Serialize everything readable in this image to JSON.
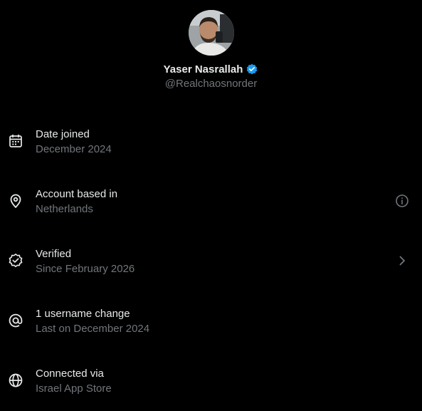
{
  "profile": {
    "name": "Yaser Nasrallah",
    "handle": "@Realchaosnorder",
    "verified_badge_icon": "verified-badge-icon",
    "badge_color": "#1d9bf0"
  },
  "rows": [
    {
      "title": "Date joined",
      "subtitle": "December 2024",
      "icon": "calendar-icon"
    },
    {
      "title": "Account based in",
      "subtitle": "Netherlands",
      "icon": "location-pin-icon",
      "action_icon": "info-icon"
    },
    {
      "title": "Verified",
      "subtitle": "Since February 2026",
      "icon": "verified-check-icon",
      "action_icon": "chevron-right-icon"
    },
    {
      "title": "1 username change",
      "subtitle": "Last on December 2024",
      "icon": "at-sign-icon"
    },
    {
      "title": "Connected via",
      "subtitle": "Israel App Store",
      "icon": "globe-icon"
    }
  ],
  "colors": {
    "background": "#000000",
    "primary_text": "#e7e9ea",
    "secondary_text": "#71767b",
    "accent": "#1d9bf0"
  }
}
